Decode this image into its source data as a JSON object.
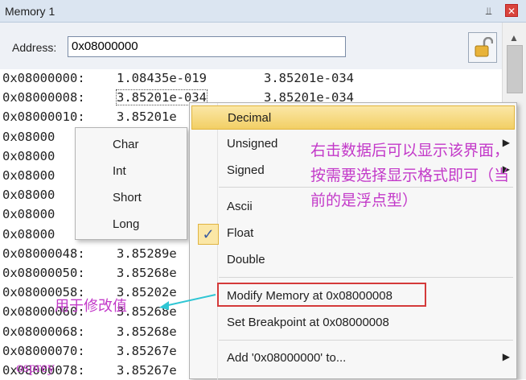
{
  "window": {
    "title": "Memory 1",
    "pin_glyph": "⫫",
    "close_glyph": "✕"
  },
  "address": {
    "label": "Address:",
    "value": "0x08000000"
  },
  "dump": {
    "rows": [
      {
        "addr": "0x08000000:",
        "v1": "1.08435e-019",
        "v2": "3.85201e-034"
      },
      {
        "addr": "0x08000008:",
        "v1": "3.85201e-034",
        "v2": "3.85201e-034"
      },
      {
        "addr": "0x08000010:",
        "v1": "3.85201e",
        "v2": ""
      },
      {
        "addr": "0x08000",
        "v1": "",
        "v2": ""
      },
      {
        "addr": "0x08000",
        "v1": "",
        "v2": ""
      },
      {
        "addr": "0x08000",
        "v1": "",
        "v2": ""
      },
      {
        "addr": "0x08000",
        "v1": "",
        "v2": ""
      },
      {
        "addr": "0x08000",
        "v1": "",
        "v2": ""
      },
      {
        "addr": "0x08000",
        "v1": "",
        "v2": ""
      },
      {
        "addr": "0x08000048:",
        "v1": "3.85289e",
        "v2": ""
      },
      {
        "addr": "0x08000050:",
        "v1": "3.85268e",
        "v2": ""
      },
      {
        "addr": "0x08000058:",
        "v1": "3.85202e",
        "v2": ""
      },
      {
        "addr": "0x08000060:",
        "v1": "3.85268e",
        "v2": ""
      },
      {
        "addr": "0x08000068:",
        "v1": "3.85268e",
        "v2": ""
      },
      {
        "addr": "0x08000070:",
        "v1": "3.85267e",
        "v2": ""
      },
      {
        "addr": "0x08000078:",
        "v1": "3.85267e",
        "v2": ""
      }
    ]
  },
  "context_menu": {
    "items": [
      {
        "label": "Decimal",
        "highlighted": true
      },
      {
        "label": "Unsigned",
        "submenu": true
      },
      {
        "label": "Signed",
        "submenu": true
      },
      {
        "label": "Ascii"
      },
      {
        "label": "Float",
        "checked": true
      },
      {
        "label": "Double"
      },
      {
        "label": "Modify Memory at 0x08000008"
      },
      {
        "label": "Set Breakpoint at 0x08000008"
      },
      {
        "label": "Add '0x08000000' to...",
        "submenu": true
      }
    ],
    "submenu_arrow": "▶",
    "check_glyph": "✓"
  },
  "submenu": {
    "items": [
      "Char",
      "Int",
      "Short",
      "Long"
    ]
  },
  "annotations": {
    "note": "右击数据后可以显示该界面，按需要选择显示格式即可（当前的是浮点型）",
    "arrow_note": "用于修改值",
    "watermark": "osprey"
  },
  "colors": {
    "annotation": "#c33ac9",
    "highlight": "#f2cf65",
    "redbox": "#d43a3a"
  }
}
